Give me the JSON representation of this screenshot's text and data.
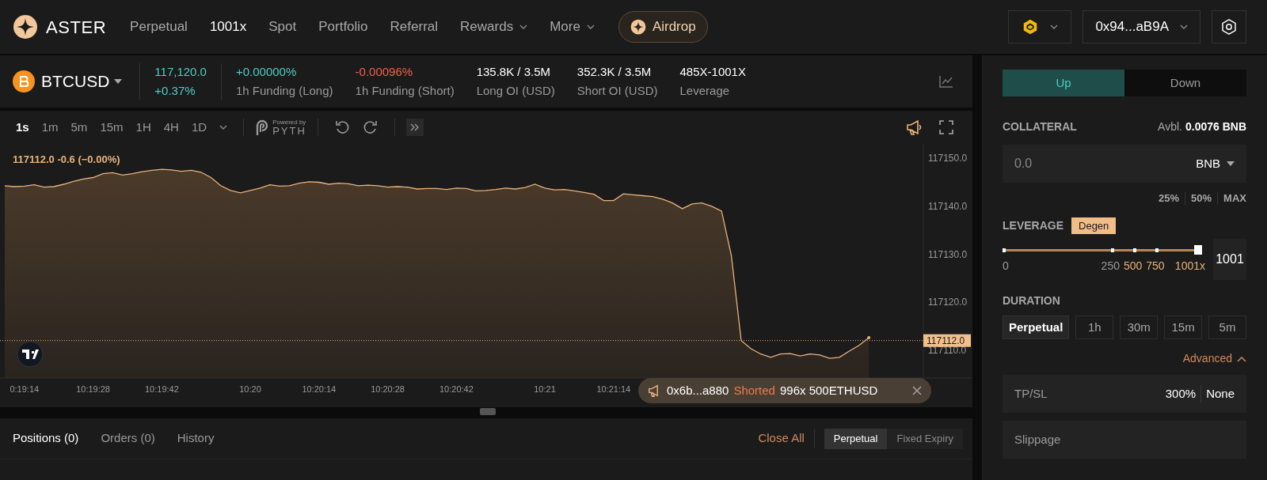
{
  "nav": {
    "brand": "ASTER",
    "items": [
      {
        "label": "Perpetual",
        "selected": false,
        "dropdown": false
      },
      {
        "label": "1001x",
        "selected": true,
        "dropdown": false
      },
      {
        "label": "Spot",
        "selected": false,
        "dropdown": false
      },
      {
        "label": "Portfolio",
        "selected": false,
        "dropdown": false
      },
      {
        "label": "Referral",
        "selected": false,
        "dropdown": false
      },
      {
        "label": "Rewards",
        "selected": false,
        "dropdown": true
      },
      {
        "label": "More",
        "selected": false,
        "dropdown": true
      }
    ],
    "airdrop": "Airdrop",
    "wallet": "0x94...aB9A"
  },
  "ticker": {
    "symbol": "BTCUSD",
    "price": "117,120.0",
    "change": "+0.37%",
    "stats": [
      {
        "value": "+0.00000%",
        "label": "1h Funding (Long)",
        "color": "#4ecdc4"
      },
      {
        "value": "-0.00096%",
        "label": "1h Funding (Short)",
        "color": "#f0624d"
      },
      {
        "value": "135.8K / 3.5M",
        "label": "Long OI (USD)",
        "color": "#ffffff"
      },
      {
        "value": "352.3K / 3.5M",
        "label": "Short OI (USD)",
        "color": "#ffffff"
      },
      {
        "value": "485X-1001X",
        "label": "Leverage",
        "color": "#ffffff"
      }
    ]
  },
  "chart_toolbar": {
    "intervals": [
      {
        "label": "1s",
        "selected": true
      },
      {
        "label": "1m",
        "selected": false
      },
      {
        "label": "5m",
        "selected": false
      },
      {
        "label": "15m",
        "selected": false
      },
      {
        "label": "1H",
        "selected": false
      },
      {
        "label": "4H",
        "selected": false
      },
      {
        "label": "1D",
        "selected": false
      }
    ],
    "powered_by": "Powered by",
    "provider": "PYTH"
  },
  "chart": {
    "legend": "117112.0  -0.6 (−0.00%)",
    "chart_data": {
      "type": "area",
      "ylim": [
        117104.2,
        117153
      ],
      "ref_lines": [
        {
          "axis": "y",
          "value": 117112,
          "label": "117112.0"
        }
      ],
      "yticks": [
        {
          "value": 117110,
          "label": "117110.0"
        },
        {
          "value": 117120,
          "label": "117120.0"
        },
        {
          "value": 117130,
          "label": "117130.0"
        },
        {
          "value": 117140,
          "label": "117140.0"
        },
        {
          "value": 117150,
          "label": "117150.0"
        }
      ],
      "categories": [
        null,
        null,
        "0:19:14",
        null,
        null,
        null,
        null,
        null,
        null,
        "10:19:28",
        null,
        null,
        null,
        null,
        null,
        null,
        "10:19:42",
        null,
        null,
        null,
        null,
        null,
        null,
        null,
        null,
        "10:20",
        null,
        null,
        null,
        null,
        null,
        null,
        "10:20:14",
        null,
        null,
        null,
        null,
        null,
        null,
        "10:20:28",
        null,
        null,
        null,
        null,
        null,
        null,
        "10:20:42",
        null,
        null,
        null,
        null,
        null,
        null,
        null,
        null,
        "10:21",
        null,
        null,
        null,
        null,
        null,
        null,
        "10:21:14",
        null,
        null,
        null,
        null,
        null,
        null,
        null,
        null,
        null,
        null,
        null,
        null,
        null,
        null,
        null,
        null,
        null,
        null,
        null,
        null,
        null,
        null,
        null,
        null,
        null,
        null
      ],
      "series": [
        {
          "color": "#e9b27c",
          "values": [
            117144.3,
            117144.1,
            117144.2,
            117144.5,
            117144.0,
            117144.1,
            117144.6,
            117145.2,
            117145.7,
            117146.0,
            117146.8,
            117147.0,
            117146.5,
            117146.8,
            117147.2,
            117147.5,
            117147.7,
            117147.6,
            117147.3,
            117147.5,
            117147.1,
            117146.0,
            117144.3,
            117143.3,
            117142.8,
            117143.3,
            117143.8,
            117144.5,
            117144.2,
            117144.3,
            117144.8,
            117145.1,
            117145.0,
            117144.6,
            117144.8,
            117144.7,
            117144.3,
            117144.4,
            117144.3,
            117144.0,
            117144.1,
            117144.0,
            117143.6,
            117143.7,
            117143.7,
            117143.5,
            117143.8,
            117143.7,
            117143.2,
            117143.3,
            117143.5,
            117143.8,
            117143.6,
            117143.9,
            117144.6,
            117143.8,
            117143.4,
            117143.5,
            117143.2,
            117142.9,
            117142.5,
            117141.2,
            117141.2,
            117142.6,
            117142.4,
            117142.2,
            117142.0,
            117141.5,
            117140.7,
            117139.5,
            117140.5,
            117140.7,
            117140.0,
            117139.0,
            117129.7,
            117112.0,
            117110.3,
            117109.2,
            117108.5,
            117109.2,
            117109.3,
            117108.8,
            117109.2,
            117109.0,
            117108.3,
            117108.5,
            117109.8,
            117111.0,
            117112.6
          ]
        }
      ]
    }
  },
  "toast": {
    "address": "0x6b...a880",
    "action": "Shorted",
    "detail": "996x 500ETHUSD"
  },
  "bottom": {
    "tabs": [
      {
        "label": "Positions (0)",
        "selected": true
      },
      {
        "label": "Orders (0)",
        "selected": false
      },
      {
        "label": "History",
        "selected": false
      }
    ],
    "close_all": "Close All",
    "modes": [
      {
        "label": "Perpetual",
        "selected": true
      },
      {
        "label": "Fixed Expiry",
        "selected": false
      }
    ]
  },
  "order": {
    "sides": [
      {
        "label": "Up",
        "selected": true
      },
      {
        "label": "Down",
        "selected": false
      }
    ],
    "collateral_label": "COLLATERAL",
    "available_label": "Avbl.",
    "available": "0.0076 BNB",
    "amount_placeholder": "0.0",
    "asset": "BNB",
    "presets": [
      "25%",
      "50%",
      "MAX"
    ],
    "leverage_label": "LEVERAGE",
    "leverage_badge": "Degen",
    "leverage": {
      "level": 1.0,
      "value": "1001",
      "marks": [
        {
          "label": "0",
          "highlighted": false
        },
        {
          "label": "250",
          "highlighted": false
        },
        {
          "label": "500",
          "highlighted": true
        },
        {
          "label": "750",
          "highlighted": true
        },
        {
          "label": "1001x",
          "highlighted": true
        }
      ]
    },
    "duration_label": "DURATION",
    "durations": [
      {
        "label": "Perpetual",
        "selected": true
      },
      {
        "label": "1h",
        "selected": false
      },
      {
        "label": "30m",
        "selected": false
      },
      {
        "label": "15m",
        "selected": false
      },
      {
        "label": "5m",
        "selected": false
      }
    ],
    "advanced": "Advanced",
    "tpsl_label": "TP/SL",
    "tp": "300%",
    "sl": "None",
    "slippage_label": "Slippage"
  }
}
